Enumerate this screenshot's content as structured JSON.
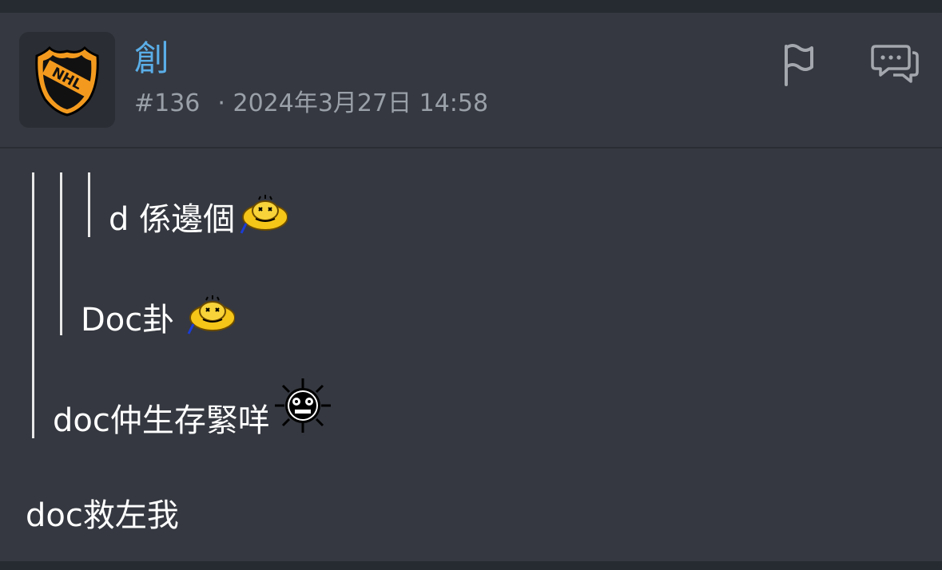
{
  "post": {
    "username": "創",
    "floor": "#136",
    "timestamp": "· 2024年3月27日 14:58",
    "avatar_text": "NHL"
  },
  "quotes": {
    "level3_text": "d 係邊個",
    "level2_text": "Doc卦",
    "level1_text": "doc仲生存緊咩"
  },
  "body": {
    "text": "doc救左我"
  },
  "icons": {
    "flag": "flag-icon",
    "reply": "comment-icon",
    "emoji_sick": "sick-face-emoji",
    "emoji_shock": "shocked-face-emoji"
  },
  "colors": {
    "username": "#5aaee8",
    "meta": "#9aa0a8",
    "background": "#353840",
    "text": "#ffffff"
  }
}
